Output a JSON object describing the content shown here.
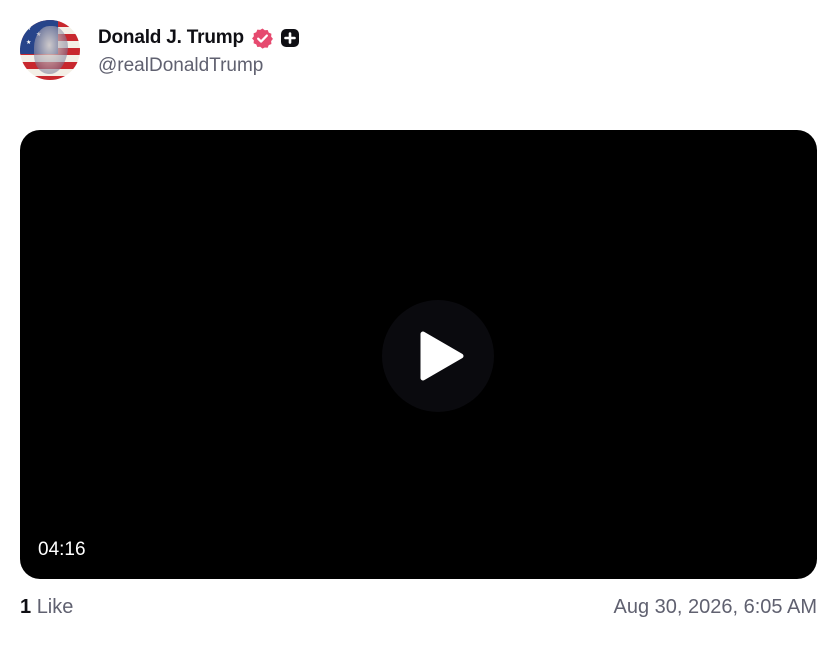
{
  "author": {
    "display_name": "Donald J. Trump",
    "handle": "@realDonaldTrump",
    "verified_badge_icon": "verified-badge-icon",
    "verified_color": "#e64a6f",
    "subscriber_icon": "plus-square-icon"
  },
  "video": {
    "duration": "04:16",
    "play_icon": "play-icon"
  },
  "footer": {
    "like_count": "1",
    "like_label": "Like",
    "timestamp": "Aug 30, 2026, 6:05 AM"
  }
}
